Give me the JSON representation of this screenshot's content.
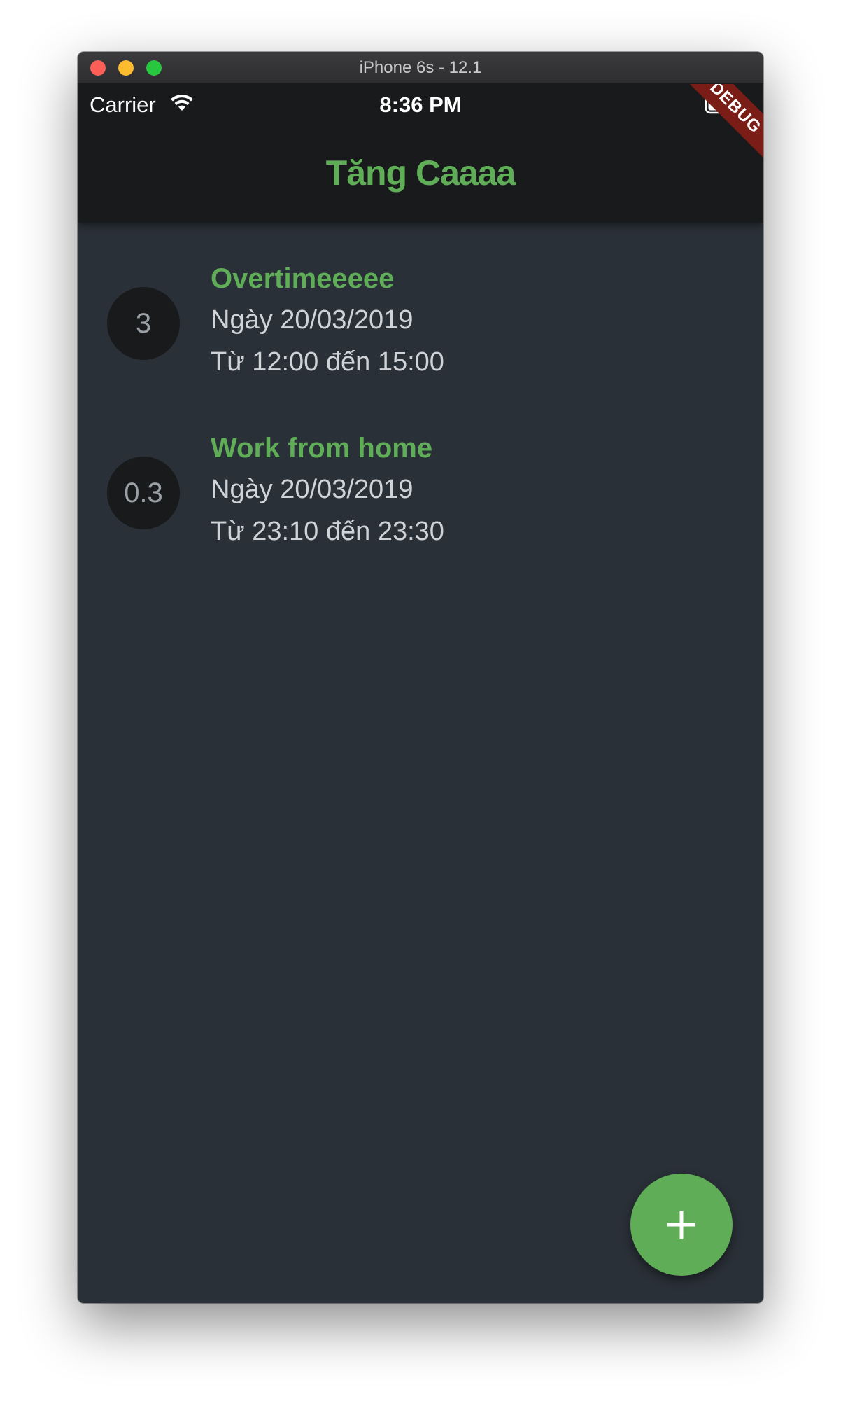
{
  "window": {
    "title": "iPhone 6s - 12.1"
  },
  "status_bar": {
    "carrier": "Carrier",
    "time": "8:36 PM",
    "wifi_icon": "wifi-icon",
    "battery_icon": "battery-full-icon"
  },
  "debug_banner": "DEBUG",
  "app_bar": {
    "title": "Tăng Caaaa"
  },
  "items": [
    {
      "badge": "3",
      "title": "Overtimeeeee",
      "date": "Ngày 20/03/2019",
      "time_range": "Từ 12:00 đến 15:00"
    },
    {
      "badge": "0.3",
      "title": "Work from home",
      "date": "Ngày 20/03/2019",
      "time_range": "Từ 23:10 đến 23:30"
    }
  ],
  "fab": {
    "icon": "plus-icon"
  },
  "colors": {
    "accent": "#5fae57",
    "background": "#2a3038",
    "app_bar": "#181a1c",
    "debug_banner": "#7b1d17"
  }
}
